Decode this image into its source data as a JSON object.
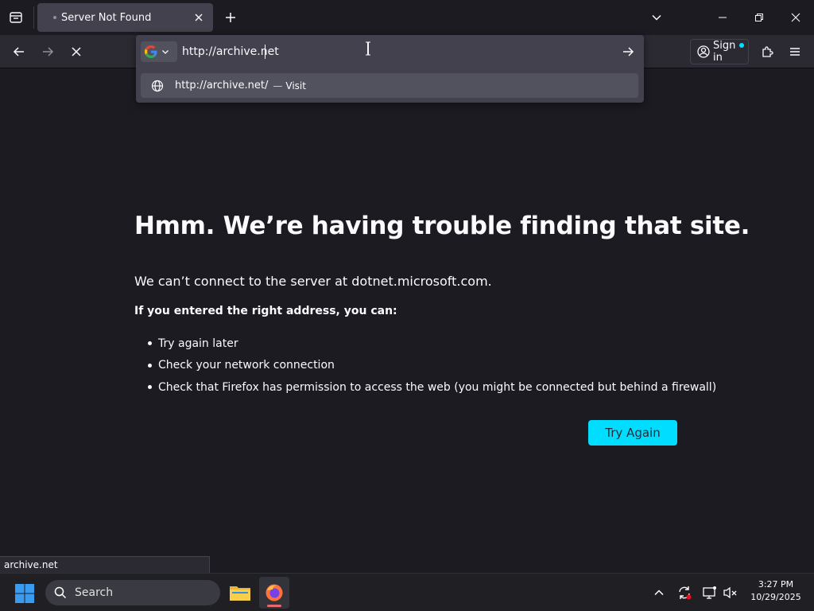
{
  "tab": {
    "title": "Server Not Found"
  },
  "toolbar": {
    "sign_in_label": "Sign in"
  },
  "urlbar": {
    "value": "http://archive.net",
    "suggestion": {
      "url": "http://archive.net/",
      "separator": "—",
      "action": "Visit"
    }
  },
  "error": {
    "title": "Hmm. We’re having trouble finding that site.",
    "description": "We can’t connect to the server at dotnet.microsoft.com.",
    "hint": "If you entered the right address, you can:",
    "suggestions": [
      "Try again later",
      "Check your network connection",
      "Check that Firefox has permission to access the web (you might be connected but behind a firewall)"
    ],
    "button": "Try Again"
  },
  "status_bar": {
    "text": "archive.net"
  },
  "taskbar": {
    "search_placeholder": "Search",
    "time": "3:27 PM",
    "date": "10/29/2025"
  },
  "colors": {
    "accent": "#00ddff",
    "page_bg": "#1c1b22",
    "toolbar_bg": "#2b2a33"
  }
}
